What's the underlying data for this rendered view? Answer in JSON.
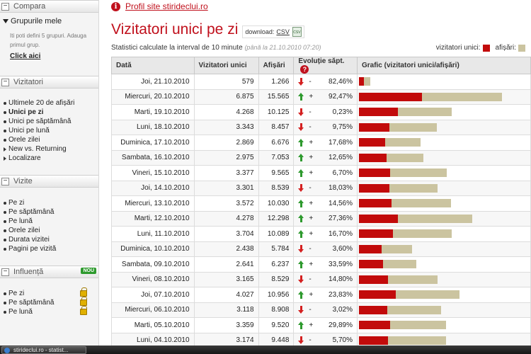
{
  "sidebar": {
    "compare_label": "Compara",
    "groups_title": "Grupurile mele",
    "groups_hint": "Iti poti defini 5 grupuri. Adauga primul grup.",
    "click_here": "Click aici",
    "visitors_header": "Vizitatori",
    "visitors_items": [
      {
        "label": "Ultimele 20 de afișări"
      },
      {
        "label": "Unici pe zi"
      },
      {
        "label": "Unici pe săptămână"
      },
      {
        "label": "Unici pe lună"
      },
      {
        "label": "Orele zilei"
      },
      {
        "label": "New vs. Returning"
      },
      {
        "label": "Localizare"
      }
    ],
    "visits_header": "Vizite",
    "visits_items": [
      {
        "label": "Pe zi"
      },
      {
        "label": "Pe săptămână"
      },
      {
        "label": "Pe lună"
      },
      {
        "label": "Orele zilei"
      },
      {
        "label": "Durata vizitei"
      },
      {
        "label": "Pagini pe vizită"
      }
    ],
    "influence_header": "Influență",
    "influence_badge": "NOU",
    "influence_items": [
      {
        "label": "Pe zi"
      },
      {
        "label": "Pe săptămână"
      },
      {
        "label": "Pe lună"
      }
    ]
  },
  "main": {
    "profile_link": "Profil site stirideclui.ro",
    "title": "Vizitatori unici pe zi",
    "download_label": "download:",
    "download_csv": "CSV",
    "csv_icon_text": "CSV",
    "stats_text": "Statistici calculate la interval de 10 minute",
    "stats_until": "(până la 21.10.2010 07:20)",
    "legend_uv": "vizitatori unici:",
    "legend_af": "afișări:",
    "colors": {
      "uv": "#c20b0b",
      "af": "#cbc4a0",
      "accent": "#c0101c",
      "up": "#2e9a2e",
      "down": "#d42020"
    },
    "headers": {
      "date": "Dată",
      "uv": "Vizitatori unici",
      "af": "Afișări",
      "evo": "Evoluție săpt.",
      "help": "?",
      "graph": "Grafic (vizitatori unici/afișări)"
    },
    "bar_scale_max": 18500,
    "rows": [
      {
        "date": "Joi, 21.10.2010",
        "uv": "579",
        "af": "1.266",
        "dir": "down",
        "sign": "-",
        "pct": "82,46%",
        "uv_n": 579,
        "af_n": 1266
      },
      {
        "date": "Miercuri, 20.10.2010",
        "uv": "6.875",
        "af": "15.565",
        "dir": "up",
        "sign": "+",
        "pct": "92,47%",
        "uv_n": 6875,
        "af_n": 15565
      },
      {
        "date": "Marti, 19.10.2010",
        "uv": "4.268",
        "af": "10.125",
        "dir": "down",
        "sign": "-",
        "pct": "0,23%",
        "uv_n": 4268,
        "af_n": 10125
      },
      {
        "date": "Luni, 18.10.2010",
        "uv": "3.343",
        "af": "8.457",
        "dir": "down",
        "sign": "-",
        "pct": "9,75%",
        "uv_n": 3343,
        "af_n": 8457
      },
      {
        "date": "Duminica, 17.10.2010",
        "uv": "2.869",
        "af": "6.676",
        "dir": "up",
        "sign": "+",
        "pct": "17,68%",
        "uv_n": 2869,
        "af_n": 6676
      },
      {
        "date": "Sambata, 16.10.2010",
        "uv": "2.975",
        "af": "7.053",
        "dir": "up",
        "sign": "+",
        "pct": "12,65%",
        "uv_n": 2975,
        "af_n": 7053
      },
      {
        "date": "Vineri, 15.10.2010",
        "uv": "3.377",
        "af": "9.565",
        "dir": "up",
        "sign": "+",
        "pct": "6,70%",
        "uv_n": 3377,
        "af_n": 9565
      },
      {
        "date": "Joi, 14.10.2010",
        "uv": "3.301",
        "af": "8.539",
        "dir": "down",
        "sign": "-",
        "pct": "18,03%",
        "uv_n": 3301,
        "af_n": 8539
      },
      {
        "date": "Miercuri, 13.10.2010",
        "uv": "3.572",
        "af": "10.030",
        "dir": "up",
        "sign": "+",
        "pct": "14,56%",
        "uv_n": 3572,
        "af_n": 10030
      },
      {
        "date": "Marti, 12.10.2010",
        "uv": "4.278",
        "af": "12.298",
        "dir": "up",
        "sign": "+",
        "pct": "27,36%",
        "uv_n": 4278,
        "af_n": 12298
      },
      {
        "date": "Luni, 11.10.2010",
        "uv": "3.704",
        "af": "10.089",
        "dir": "up",
        "sign": "+",
        "pct": "16,70%",
        "uv_n": 3704,
        "af_n": 10089
      },
      {
        "date": "Duminica, 10.10.2010",
        "uv": "2.438",
        "af": "5.784",
        "dir": "down",
        "sign": "-",
        "pct": "3,60%",
        "uv_n": 2438,
        "af_n": 5784
      },
      {
        "date": "Sambata, 09.10.2010",
        "uv": "2.641",
        "af": "6.237",
        "dir": "up",
        "sign": "+",
        "pct": "33,59%",
        "uv_n": 2641,
        "af_n": 6237
      },
      {
        "date": "Vineri, 08.10.2010",
        "uv": "3.165",
        "af": "8.529",
        "dir": "down",
        "sign": "-",
        "pct": "14,80%",
        "uv_n": 3165,
        "af_n": 8529
      },
      {
        "date": "Joi, 07.10.2010",
        "uv": "4.027",
        "af": "10.956",
        "dir": "up",
        "sign": "+",
        "pct": "23,83%",
        "uv_n": 4027,
        "af_n": 10956
      },
      {
        "date": "Miercuri, 06.10.2010",
        "uv": "3.118",
        "af": "8.908",
        "dir": "down",
        "sign": "-",
        "pct": "3,02%",
        "uv_n": 3118,
        "af_n": 8908
      },
      {
        "date": "Marti, 05.10.2010",
        "uv": "3.359",
        "af": "9.520",
        "dir": "up",
        "sign": "+",
        "pct": "29,89%",
        "uv_n": 3359,
        "af_n": 9520
      },
      {
        "date": "Luni, 04.10.2010",
        "uv": "3.174",
        "af": "9.448",
        "dir": "down",
        "sign": "-",
        "pct": "5,70%",
        "uv_n": 3174,
        "af_n": 9448
      }
    ]
  },
  "taskbar": {
    "window_label": "stirideclui.ro - statist..."
  }
}
